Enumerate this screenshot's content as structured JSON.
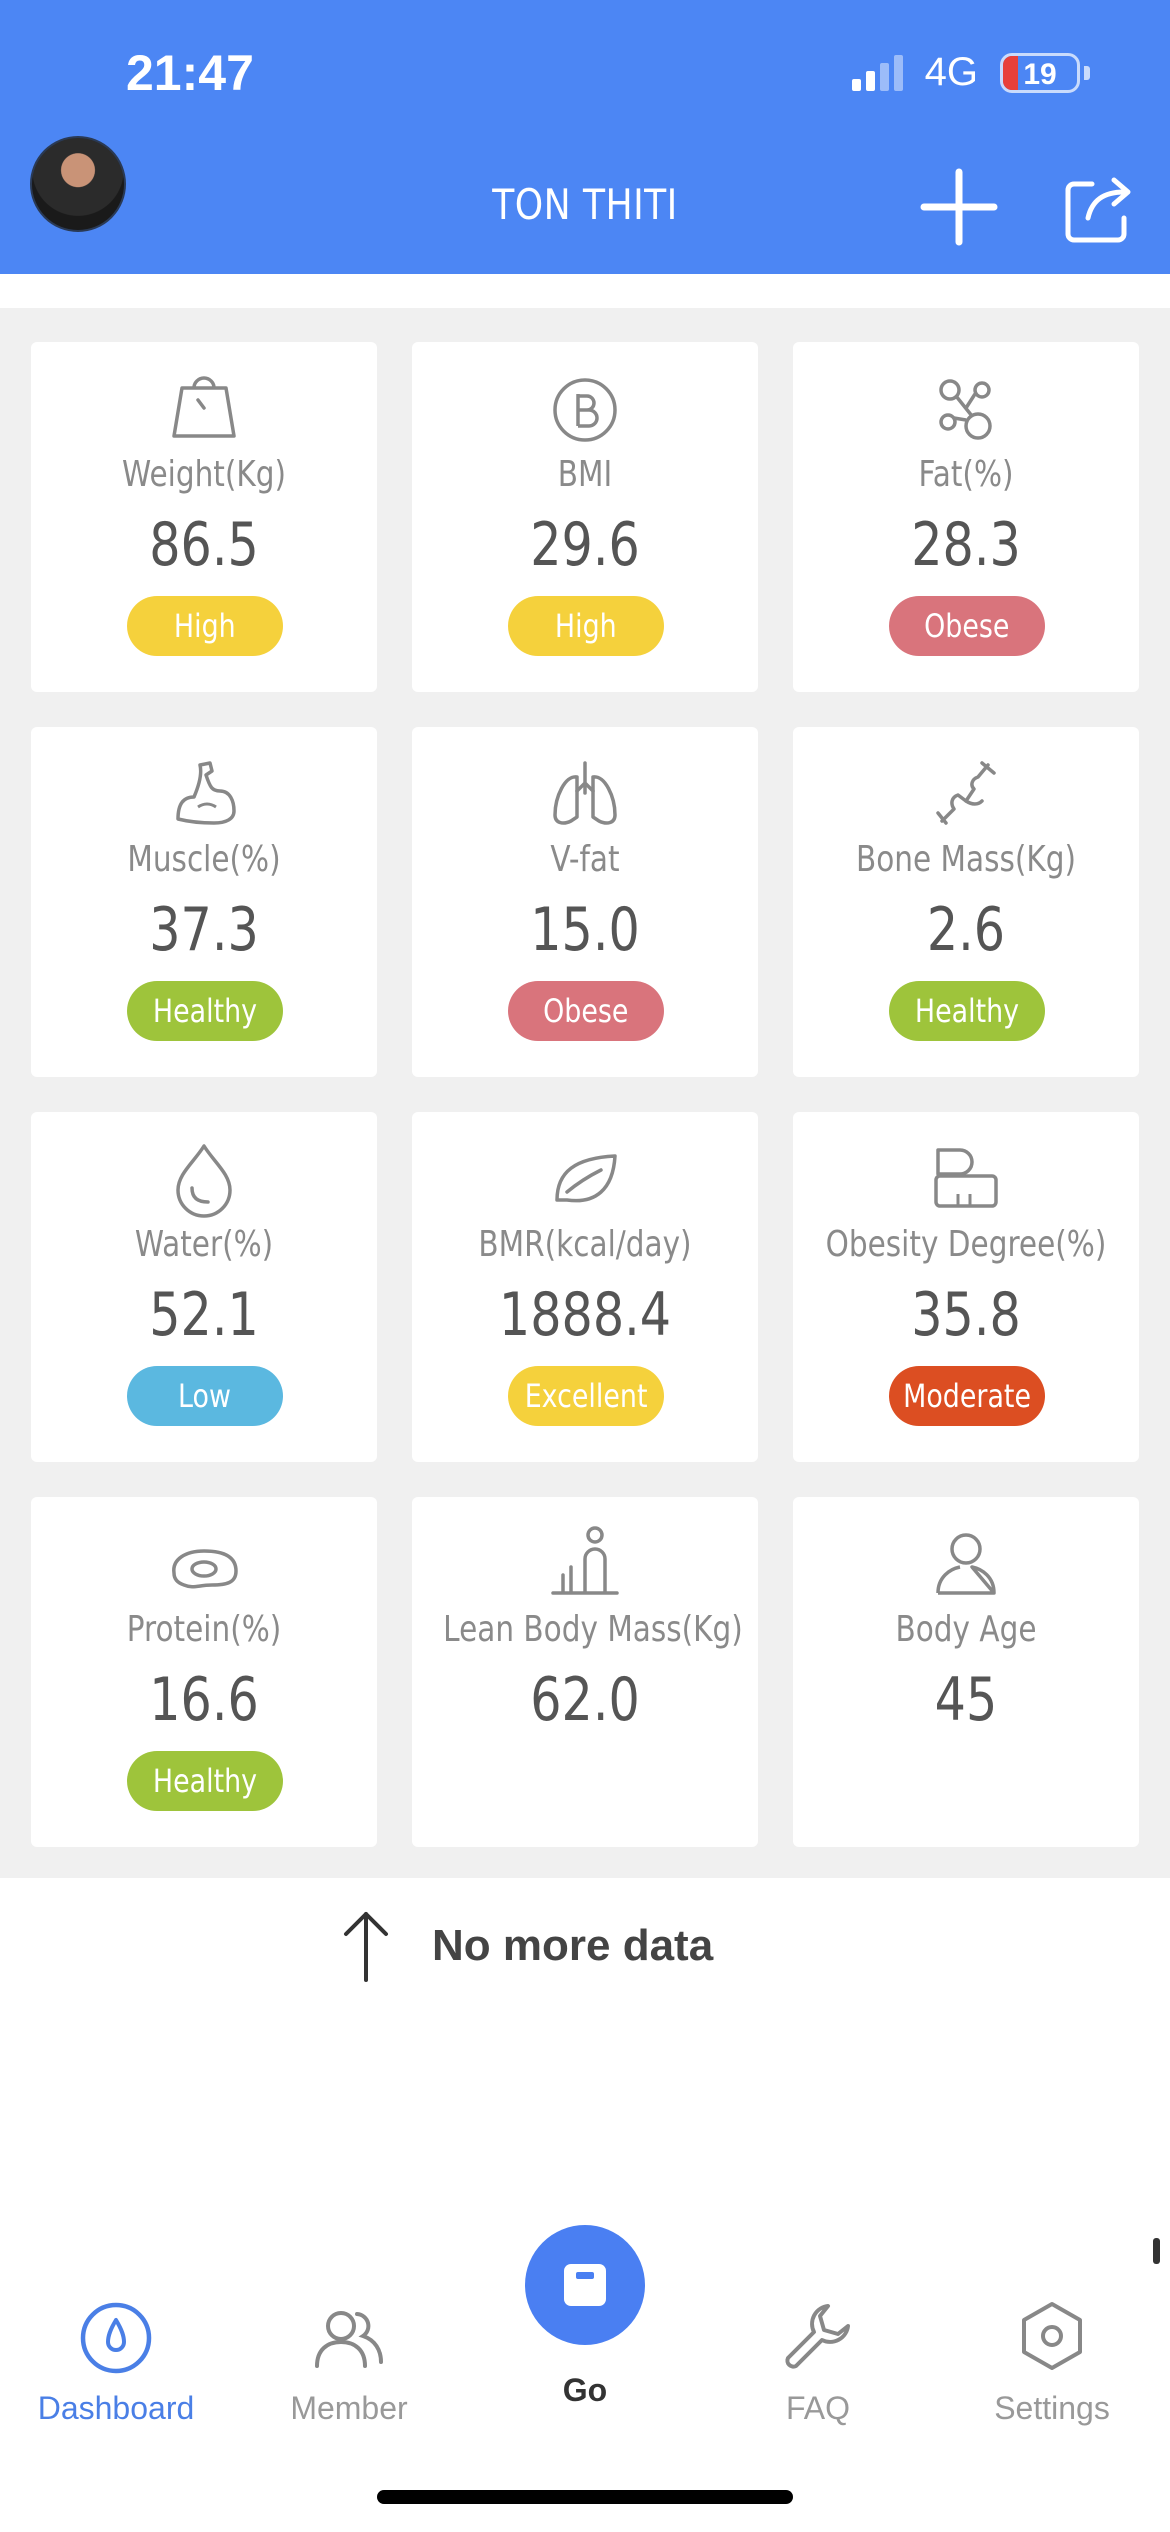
{
  "status_bar": {
    "time": "21:47",
    "network": "4G",
    "battery": "19"
  },
  "header": {
    "title": "TON THITI"
  },
  "metrics": [
    {
      "icon": "weight-scale-icon",
      "label": "Weight(Kg)",
      "value": "86.5",
      "status": "High",
      "status_color": "#f5d13c"
    },
    {
      "icon": "bmi-icon",
      "label": "BMI",
      "value": "29.6",
      "status": "High",
      "status_color": "#f5d13c"
    },
    {
      "icon": "fat-icon",
      "label": "Fat(%)",
      "value": "28.3",
      "status": "Obese",
      "status_color": "#d9747c"
    },
    {
      "icon": "muscle-arm-icon",
      "label": "Muscle(%)",
      "value": "37.3",
      "status": "Healthy",
      "status_color": "#9ec43b"
    },
    {
      "icon": "lungs-icon",
      "label": "V-fat",
      "value": "15.0",
      "status": "Obese",
      "status_color": "#d9747c"
    },
    {
      "icon": "bone-icon",
      "label": "Bone Mass(Kg)",
      "value": "2.6",
      "status": "Healthy",
      "status_color": "#9ec43b"
    },
    {
      "icon": "water-drop-icon",
      "label": "Water(%)",
      "value": "52.1",
      "status": "Low",
      "status_color": "#5bb8e0"
    },
    {
      "icon": "leaf-icon",
      "label": "BMR(kcal/day)",
      "value": "1888.4",
      "status": "Excellent",
      "status_color": "#f5d13c"
    },
    {
      "icon": "obesity-scale-icon",
      "label": "Obesity Degree(%)",
      "value": "35.8",
      "status": "Moderate",
      "status_color": "#dc4e22"
    },
    {
      "icon": "protein-icon",
      "label": "Protein(%)",
      "value": "16.6",
      "status": "Healthy",
      "status_color": "#9ec43b"
    },
    {
      "icon": "body-figure-icon",
      "label": "Lean Body Mass(Kg)",
      "value": "62.0",
      "status": "",
      "status_color": ""
    },
    {
      "icon": "person-icon",
      "label": "Body Age",
      "value": "45",
      "status": "",
      "status_color": ""
    }
  ],
  "footer_text": "No more data",
  "nav": {
    "dashboard": "Dashboard",
    "member": "Member",
    "go": "Go",
    "faq": "FAQ",
    "settings": "Settings"
  },
  "colors": {
    "accent": "#4c86f4",
    "active_nav": "#4a7fe6"
  }
}
